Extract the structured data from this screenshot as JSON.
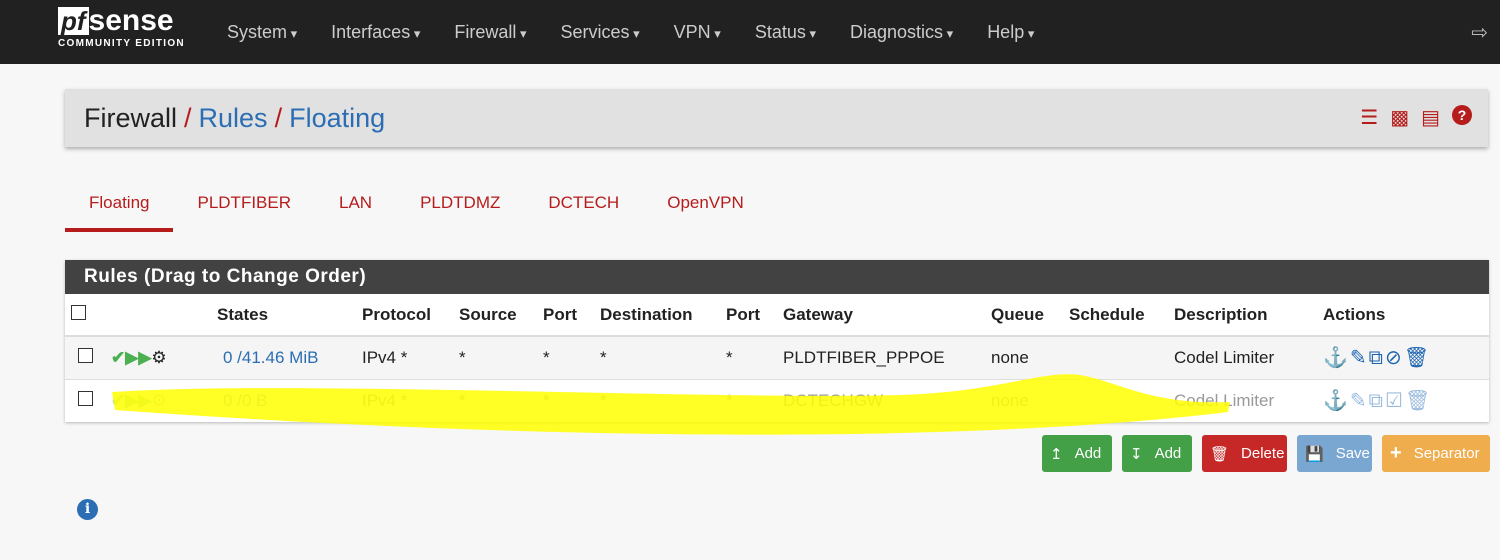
{
  "nav": {
    "logo_main": "pfsense",
    "logo_sub": "COMMUNITY EDITION",
    "menu": [
      "System",
      "Interfaces",
      "Firewall",
      "Services",
      "VPN",
      "Status",
      "Diagnostics",
      "Help"
    ]
  },
  "breadcrumb": {
    "root": "Firewall",
    "level1": "Rules",
    "level2": "Floating"
  },
  "tabs": [
    "Floating",
    "PLDTFIBER",
    "LAN",
    "PLDTDMZ",
    "DCTECH",
    "OpenVPN"
  ],
  "panel": {
    "title": "Rules (Drag to Change Order)",
    "headers": [
      "",
      "",
      "States",
      "Protocol",
      "Source",
      "Port",
      "Destination",
      "Port",
      "Gateway",
      "Queue",
      "Schedule",
      "Description",
      "Actions"
    ],
    "rows": [
      {
        "states": "0 /41.46 MiB",
        "protocol": "IPv4 *",
        "source": "*",
        "sport": "*",
        "destination": "*",
        "dport": "*",
        "gateway": "PLDTFIBER_PPPOE",
        "queue": "none",
        "schedule": "",
        "description": "Codel Limiter",
        "enabled": true
      },
      {
        "states": "0 /0 B",
        "protocol": "IPv4 *",
        "source": "*",
        "sport": "*",
        "destination": "*",
        "dport": "*",
        "gateway": "DCTECHGW",
        "queue": "none",
        "schedule": "",
        "description": "Codel Limiter",
        "enabled": false
      }
    ]
  },
  "buttons": {
    "add_top": "Add",
    "add_bottom": "Add",
    "delete": "Delete",
    "save": "Save",
    "separator": "Separator"
  },
  "colors": {
    "accent": "#b71c1c",
    "link": "#2b6eb3",
    "success": "#43a047",
    "danger": "#c62828",
    "save": "#7aa6d2",
    "separator": "#f0ad4e",
    "highlight": "#ffff00"
  }
}
